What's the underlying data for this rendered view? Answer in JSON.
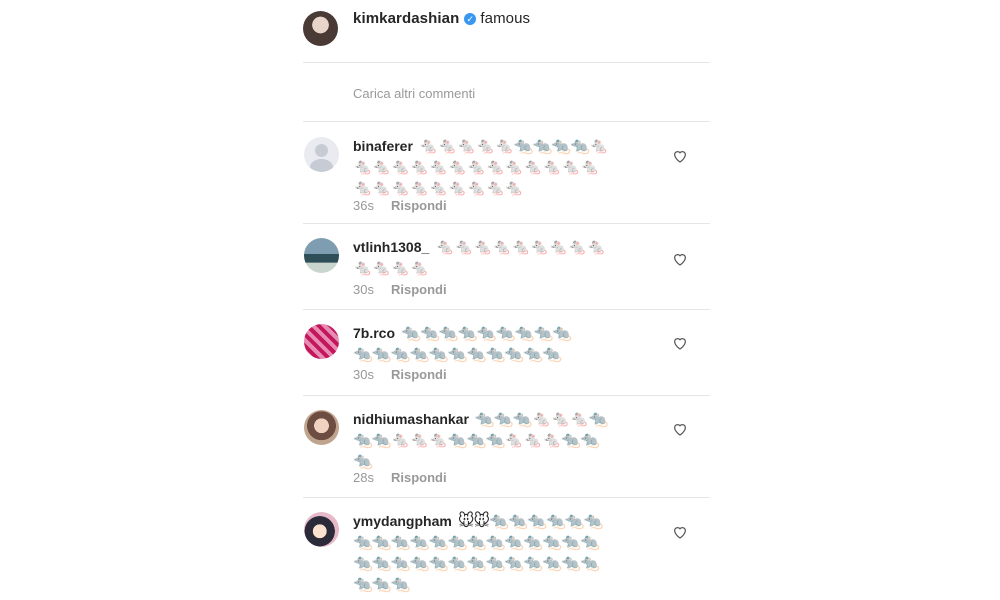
{
  "post": {
    "username": "kimkardashian",
    "verified_icon": "verified-check-icon",
    "caption": "famous"
  },
  "load_more_label": "Carica altri commenti",
  "comments": [
    {
      "username": "binaferer",
      "avatar": "default-avatar",
      "emoji_lines": [
        "🐁🐁🐁🐁🐁🐀🐀🐀🐀🐁",
        "🐁🐁🐁🐁🐁🐁🐁🐁🐁🐁🐁🐁🐁",
        "🐁🐁🐁🐁🐁🐁🐁🐁🐁"
      ],
      "time": "36s",
      "reply_label": "Rispondi",
      "like_icon": "heart-icon"
    },
    {
      "username": "vtlinh1308_",
      "avatar": "landscape-avatar",
      "emoji_lines": [
        "🐁🐁🐁🐁🐁🐁🐁🐁🐁",
        "🐁🐁🐁🐁"
      ],
      "time": "30s",
      "reply_label": "Rispondi",
      "like_icon": "heart-icon"
    },
    {
      "username": "7b.rco",
      "avatar": "pink-pattern-avatar",
      "emoji_lines": [
        "🐀🐀🐀🐀🐀🐀🐀🐀🐀",
        "🐀🐀🐀🐀🐀🐀🐀🐀🐀🐀🐀"
      ],
      "time": "30s",
      "reply_label": "Rispondi",
      "like_icon": "heart-icon"
    },
    {
      "username": "nidhiumashankar",
      "avatar": "girl-avatar",
      "emoji_lines": [
        "🐀🐀🐀🐁🐁🐁🐀",
        "🐀🐀🐁🐁🐁🐀🐀🐀🐁🐁🐁🐀🐀",
        "🐀"
      ],
      "time": "28s",
      "reply_label": "Rispondi",
      "like_icon": "heart-icon"
    },
    {
      "username": "ymydangpham",
      "avatar": "anime-avatar",
      "emoji_lines": [
        "🐭🐭🐀🐀🐀🐀🐀🐀",
        "🐀🐀🐀🐀🐀🐀🐀🐀🐀🐀🐀🐀🐀",
        "🐀🐀🐀🐀🐀🐀🐀🐀🐀🐀🐀🐀🐀",
        "🐀🐀🐀"
      ],
      "like_icon": "heart-icon"
    }
  ]
}
